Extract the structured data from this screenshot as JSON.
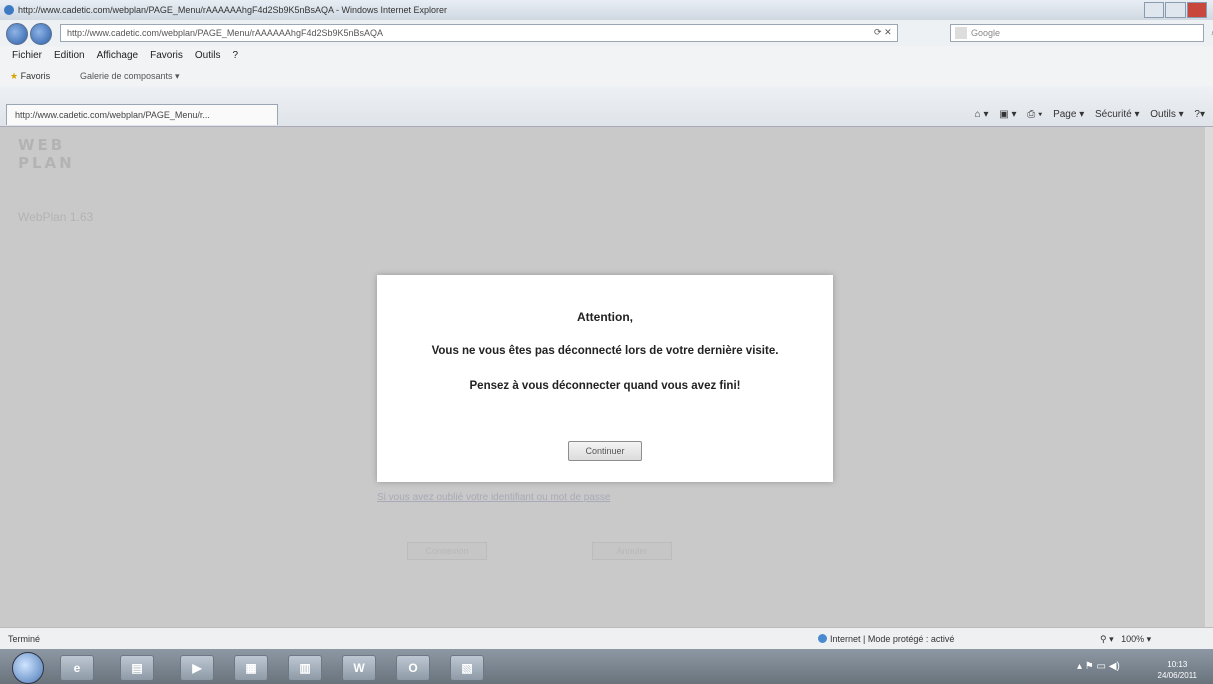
{
  "window": {
    "title": "http://www.cadetic.com/webplan/PAGE_Menu/rAAAAAAhgF4d2Sb9K5nBsAQA - Windows Internet Explorer"
  },
  "address_bar": {
    "url": "http://www.cadetic.com/webplan/PAGE_Menu/rAAAAAAhgF4d2Sb9K5nBsAQA",
    "search_placeholder": "Google"
  },
  "menu": {
    "items": [
      "Fichier",
      "Edition",
      "Affichage",
      "Favoris",
      "Outils",
      "?"
    ]
  },
  "favorites_bar": {
    "favorites_label": "Favoris",
    "gallery_label": "Galerie de composants ▾"
  },
  "tab": {
    "title": "http://www.cadetic.com/webplan/PAGE_Menu/r..."
  },
  "command_bar": {
    "page": "Page ▾",
    "security": "Sécurité ▾",
    "tools": "Outils ▾"
  },
  "page": {
    "logo_line1": "WEB",
    "logo_line2": "PLAN",
    "version": "WebPlan 1.63",
    "forgot_link": "Si vous avez oublié votre identifiant ou mot de passe",
    "btn_left": "Connexion",
    "btn_right": "Annuler"
  },
  "modal": {
    "title": "Attention,",
    "line1": "Vous ne vous êtes pas déconnecté lors de votre dernière visite.",
    "line2": "Pensez à vous déconnecter quand vous avez fini!",
    "button": "Continuer"
  },
  "status_bar": {
    "left": "Terminé",
    "zone": "Internet | Mode protégé : activé",
    "zoom": "100%"
  },
  "taskbar": {
    "time": "10:13",
    "date": "24/06/2011"
  }
}
